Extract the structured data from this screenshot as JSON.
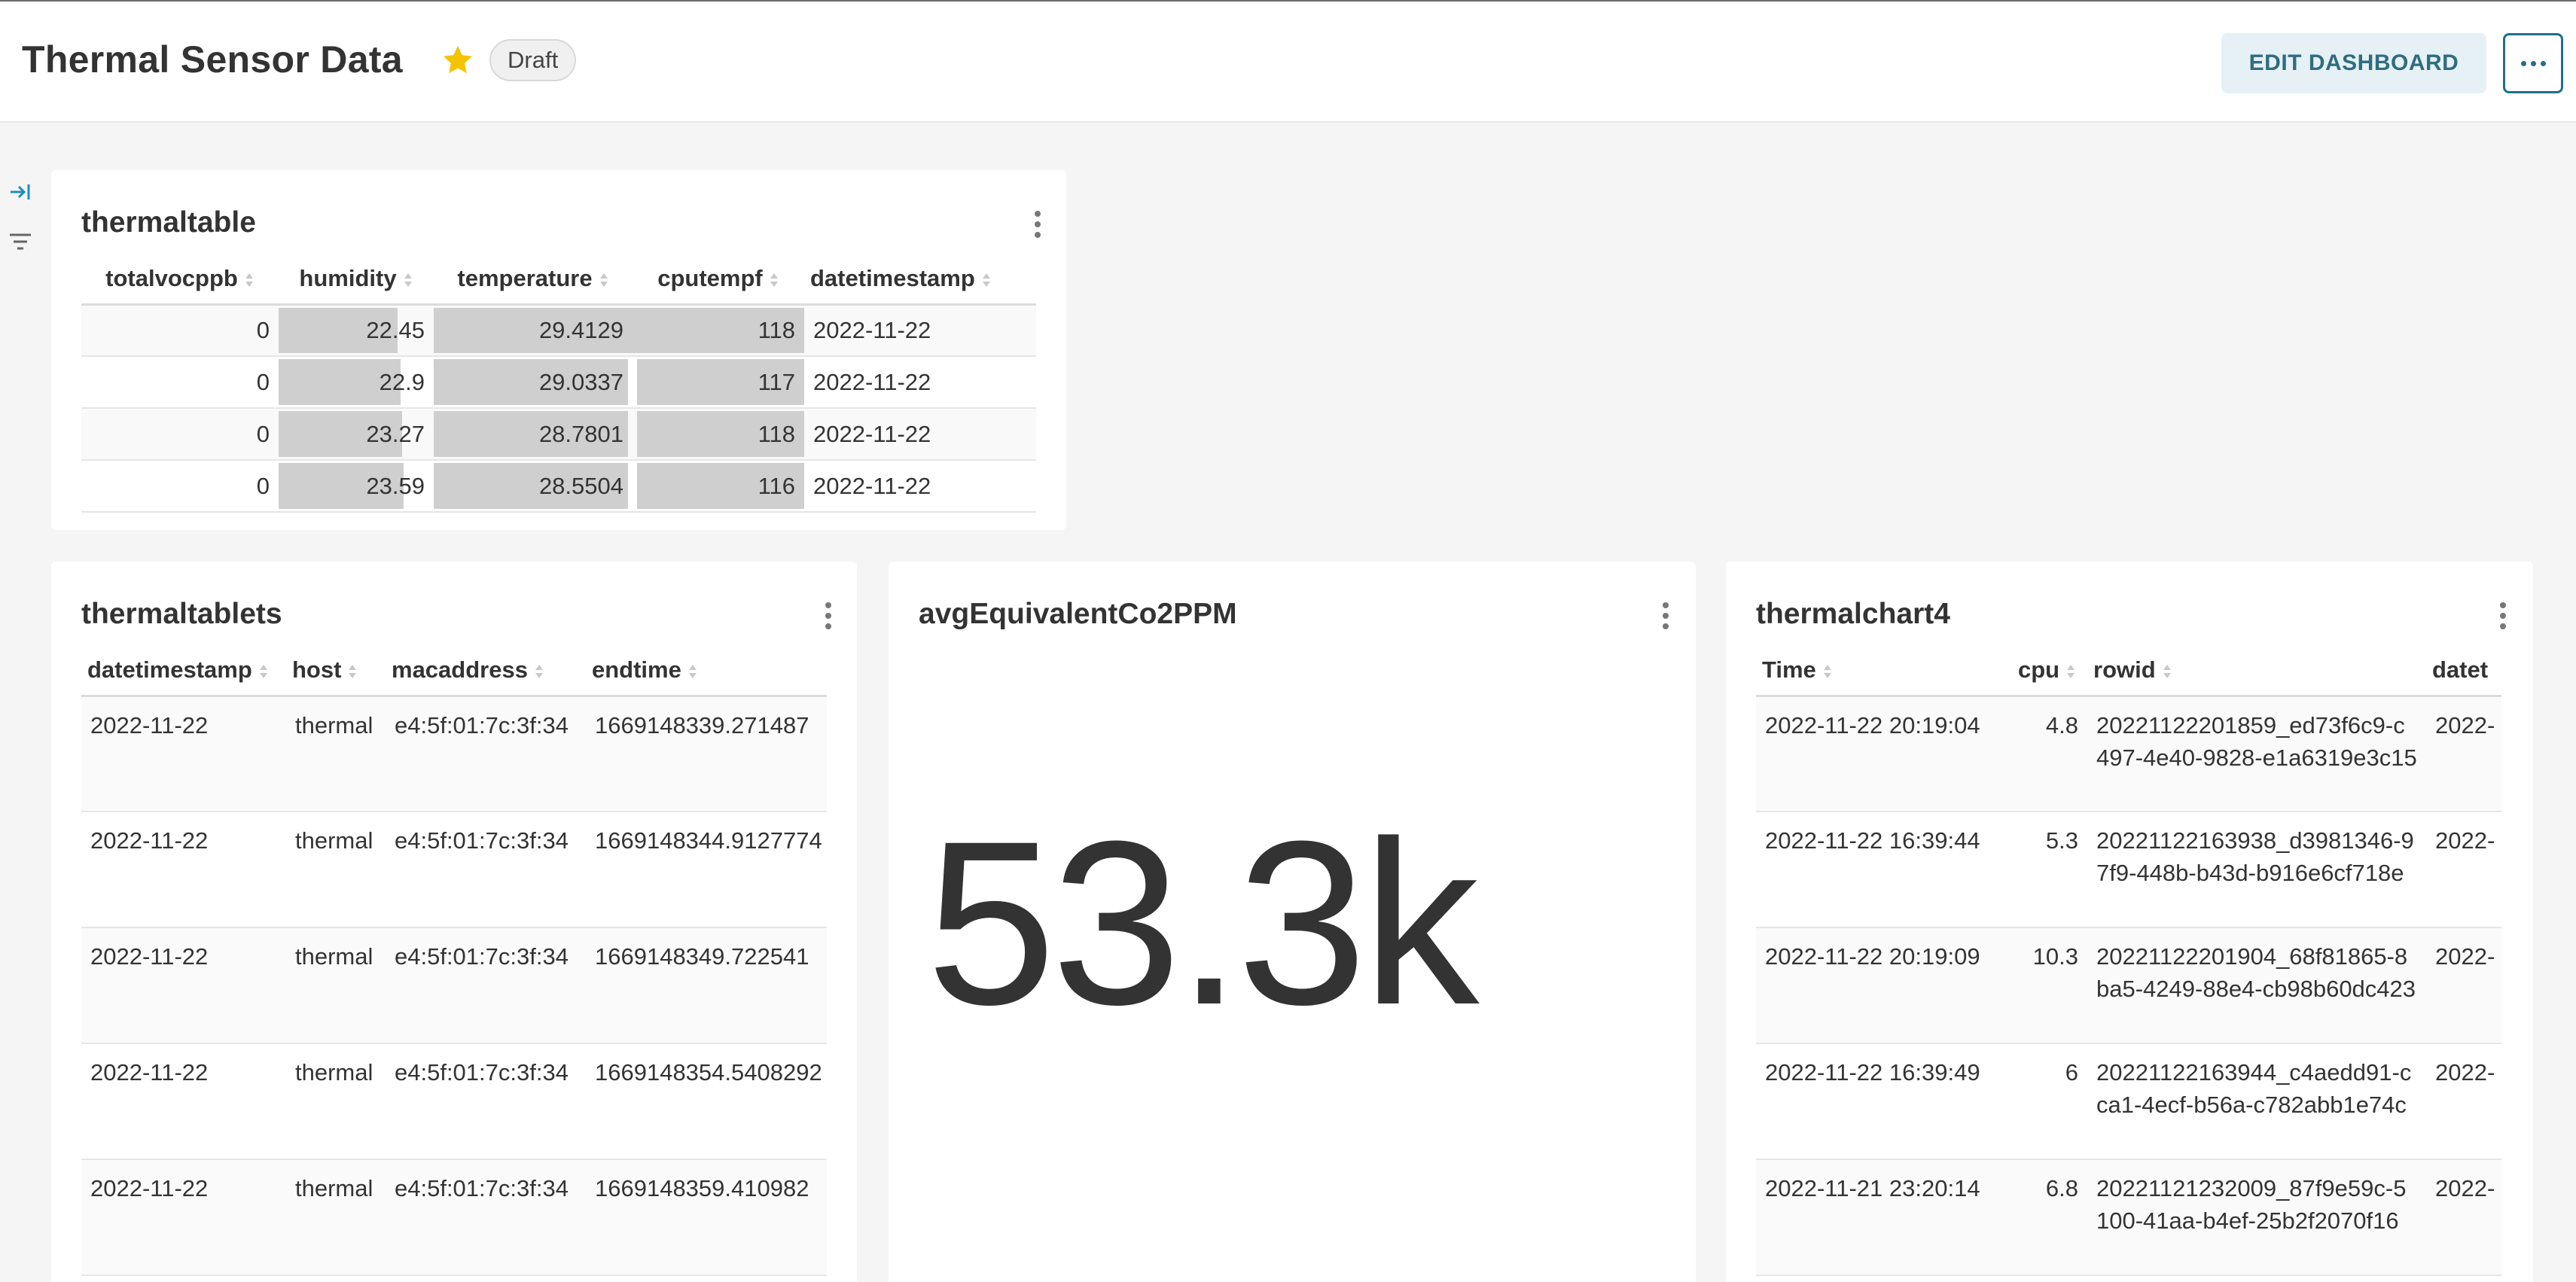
{
  "header": {
    "title": "Thermal Sensor Data",
    "badge": "Draft",
    "edit_label": "EDIT DASHBOARD",
    "favorite_color": "#f5c400"
  },
  "thermaltable": {
    "title": "thermaltable",
    "columns": [
      "totalvocppb",
      "humidity",
      "temperature",
      "cputempf",
      "datetimestamp"
    ],
    "rows": [
      [
        "0",
        "22.45",
        "29.4129",
        "118",
        "2022-11-22"
      ],
      [
        "0",
        "22.9",
        "29.0337",
        "117",
        "2022-11-22"
      ],
      [
        "0",
        "23.27",
        "28.7801",
        "118",
        "2022-11-22"
      ],
      [
        "0",
        "23.59",
        "28.5504",
        "116",
        "2022-11-22"
      ]
    ]
  },
  "thermaltablets": {
    "title": "thermaltablets",
    "columns": [
      "datetimestamp",
      "host",
      "macaddress",
      "endtime"
    ],
    "rows": [
      [
        "2022-11-22",
        "thermal",
        "e4:5f:01:7c:3f:34",
        "1669148339.271487"
      ],
      [
        "2022-11-22",
        "thermal",
        "e4:5f:01:7c:3f:34",
        "1669148344.9127774"
      ],
      [
        "2022-11-22",
        "thermal",
        "e4:5f:01:7c:3f:34",
        "1669148349.722541"
      ],
      [
        "2022-11-22",
        "thermal",
        "e4:5f:01:7c:3f:34",
        "1669148354.5408292"
      ],
      [
        "2022-11-22",
        "thermal",
        "e4:5f:01:7c:3f:34",
        "1669148359.410982"
      ]
    ]
  },
  "bignumber": {
    "title": "avgEquivalentCo2PPM",
    "value": "53.3k"
  },
  "thermalchart4": {
    "title": "thermalchart4",
    "columns": [
      "Time",
      "cpu",
      "rowid",
      "datet"
    ],
    "rows": [
      [
        "2022-11-22 20:19:04",
        "4.8",
        "20221122201859_ed73f6c9-c497-4e40-9828-e1a6319e3c15",
        "2022-"
      ],
      [
        "2022-11-22 16:39:44",
        "5.3",
        "20221122163938_d3981346-97f9-448b-b43d-b916e6cf718e",
        "2022-"
      ],
      [
        "2022-11-22 20:19:09",
        "10.3",
        "20221122201904_68f81865-8ba5-4249-88e4-cb98b60dc423",
        "2022-"
      ],
      [
        "2022-11-22 16:39:49",
        "6",
        "20221122163944_c4aedd91-cca1-4ecf-b56a-c782abb1e74c",
        "2022-"
      ],
      [
        "2022-11-21 23:20:14",
        "6.8",
        "20221121232009_87f9e59c-5100-41aa-b4ef-25b2f2070f16",
        "2022-"
      ]
    ]
  }
}
